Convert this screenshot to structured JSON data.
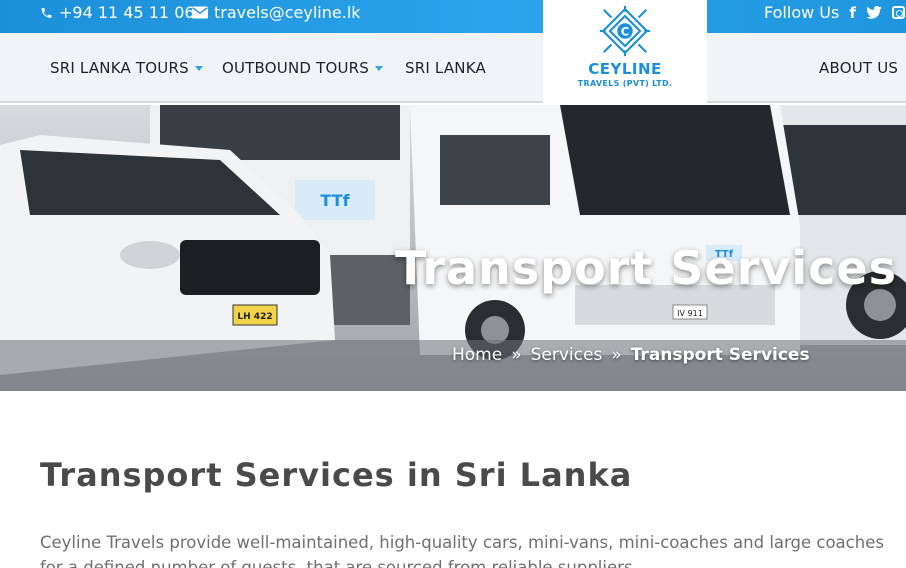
{
  "topbar": {
    "phone": "+94 11 45 11 064",
    "email": "travels@ceyline.lk",
    "follow_label": "Follow Us",
    "social_icons": [
      "facebook-icon",
      "twitter-icon",
      "instagram-icon"
    ],
    "color": "#1c8fd8"
  },
  "nav": {
    "items": [
      {
        "label": "SRI LANKA TOURS",
        "has_dropdown": true
      },
      {
        "label": "OUTBOUND TOURS",
        "has_dropdown": true
      },
      {
        "label": "SRI LANKA",
        "has_dropdown": false
      },
      {
        "label": "ABOUT US",
        "has_dropdown": false
      }
    ]
  },
  "logo": {
    "letter": "C",
    "name": "CEYLINE",
    "sub": "TRAVELS (PVT) LTD.",
    "color": "#1c8fd8"
  },
  "hero": {
    "title": "Transport Services",
    "breadcrumb": [
      "Home",
      "Services",
      "Transport Services"
    ],
    "separator": "»",
    "plates": [
      "LH 422",
      "IV 911"
    ],
    "decal": "TTf"
  },
  "content": {
    "heading": "Transport Services in Sri Lanka",
    "paragraph": "Ceyline Travels provide well-maintained, high-quality cars, mini-vans, mini-coaches and large coaches for a defined number of guests, that are sourced from reliable suppliers."
  }
}
